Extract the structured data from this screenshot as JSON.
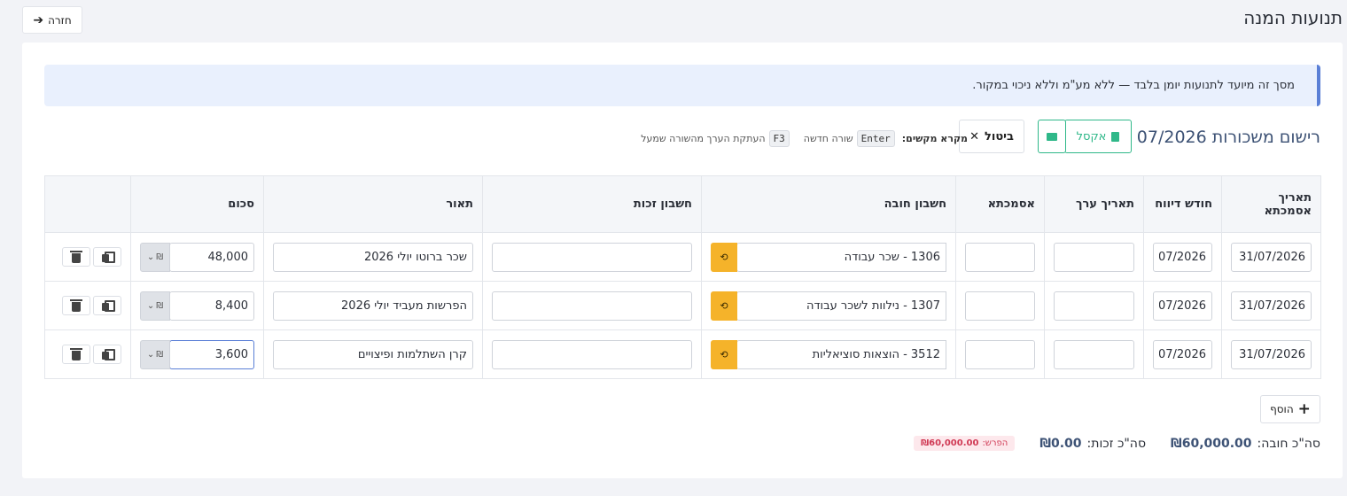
{
  "page": {
    "title": "תנועות המנה",
    "back_label": "חזרה"
  },
  "notice": "מסך זה מיועד לתנועות יומן בלבד — ללא מע\"מ וללא ניכוי במקור.",
  "section": {
    "title": "רישום משכורות 07/2026",
    "excel_label": "אקסל",
    "cancel_label": "ביטול"
  },
  "shortcuts": {
    "legend_label": "מקרא מקשים:",
    "key1": "Enter",
    "key1_desc": "שורה חדשה",
    "key2": "F3",
    "key2_desc": "העתקת הערך מהשורה שמעל"
  },
  "table": {
    "headers": {
      "ref_date": "תאריך אסמכתא",
      "report_month": "חודש דיווח",
      "value_date": "תאריך ערך",
      "reference": "אסמכתא",
      "debit_account": "חשבון חובה",
      "credit_account": "חשבון זכות",
      "description": "תאור",
      "amount": "סכום"
    },
    "currency_symbol": "₪",
    "rows": [
      {
        "ref_date": "31/07/2026",
        "report_month": "07/2026",
        "value_date": "",
        "reference": "",
        "debit_account": "1306 - שכר עבודה",
        "credit_account": "",
        "description": "שכר ברוטו יולי 2026",
        "amount": "48,000"
      },
      {
        "ref_date": "31/07/2026",
        "report_month": "07/2026",
        "value_date": "",
        "reference": "",
        "debit_account": "1307 - נילוות לשכר עבודה",
        "credit_account": "",
        "description": "הפרשות מעביד יולי 2026",
        "amount": "8,400"
      },
      {
        "ref_date": "31/07/2026",
        "report_month": "07/2026",
        "value_date": "",
        "reference": "",
        "debit_account": "3512 - הוצאות סוציאליות",
        "credit_account": "",
        "description": "קרן השתלמות ופיצויים",
        "amount": "3,600"
      }
    ]
  },
  "add_label": "הוסף",
  "totals": {
    "debit_label": "סה\"כ חובה:",
    "debit_value": "₪60,000.00",
    "credit_label": "סה\"כ זכות:",
    "credit_value": "₪0.00",
    "diff_label": "הפרש:",
    "diff_value": "₪60,000.00"
  },
  "colors": {
    "accent_green": "#2fb889",
    "account_button": "#f5b32a",
    "notice_border": "#5a7fd6",
    "diff_text": "#d03a55"
  }
}
